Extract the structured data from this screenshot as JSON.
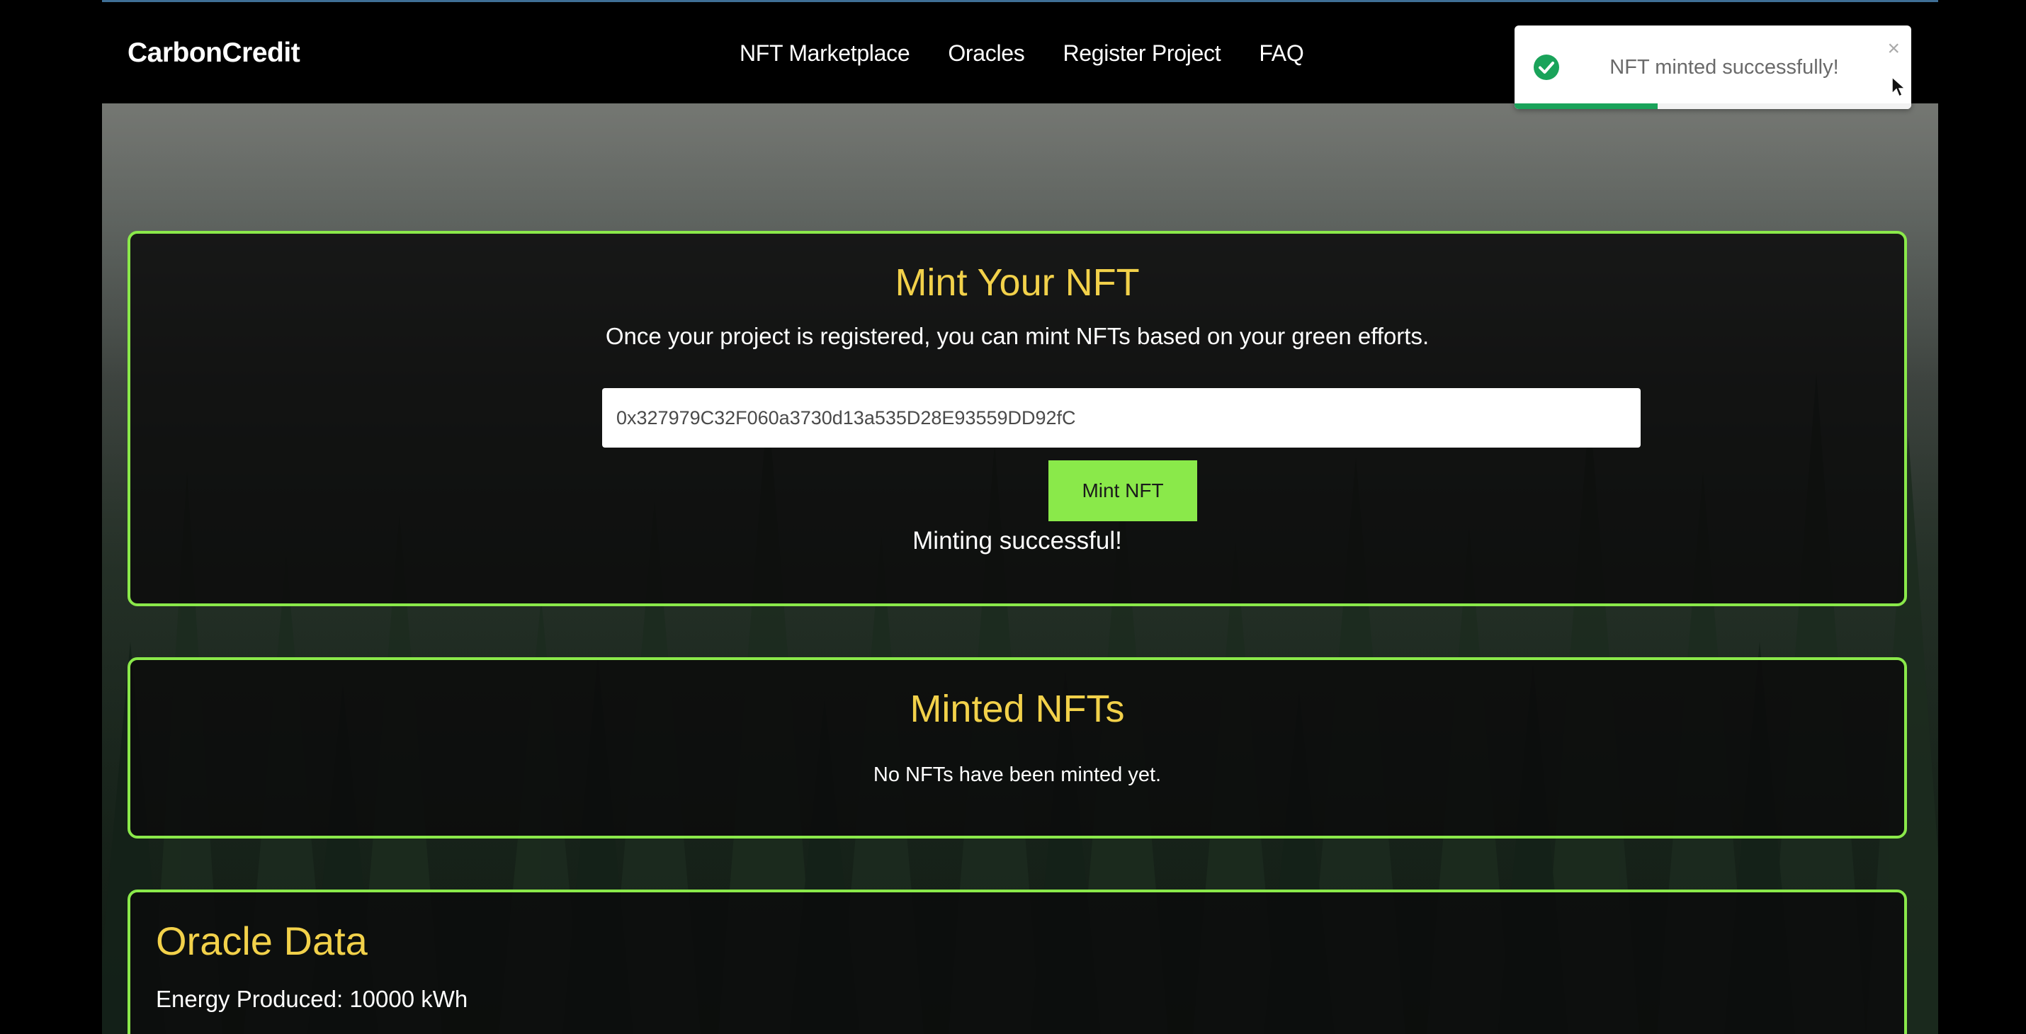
{
  "navbar": {
    "brand": "CarbonCredit",
    "links": [
      {
        "label": "NFT Marketplace"
      },
      {
        "label": "Oracles"
      },
      {
        "label": "Register Project"
      },
      {
        "label": "FAQ"
      }
    ]
  },
  "toast": {
    "message": "NFT minted successfully!",
    "close_glyph": "×",
    "icon": "check-circle-icon",
    "progress_remaining": 0.36,
    "accent_color": "#1aa35a"
  },
  "mint": {
    "title": "Mint Your NFT",
    "subtitle": "Once your project is registered, you can mint NFTs based on your green efforts.",
    "address_value": "0x327979C32F060a3730d13a535D28E93559DD92fC",
    "button_label": "Mint NFT",
    "status": "Minting successful!"
  },
  "minted": {
    "title": "Minted NFTs",
    "empty_message": "No NFTs have been minted yet."
  },
  "oracle": {
    "title": "Oracle Data",
    "energy_line": "Energy Produced: 10000 kWh"
  },
  "colors": {
    "accent_green": "#8ae94a",
    "heading_yellow": "#f2d14a"
  }
}
